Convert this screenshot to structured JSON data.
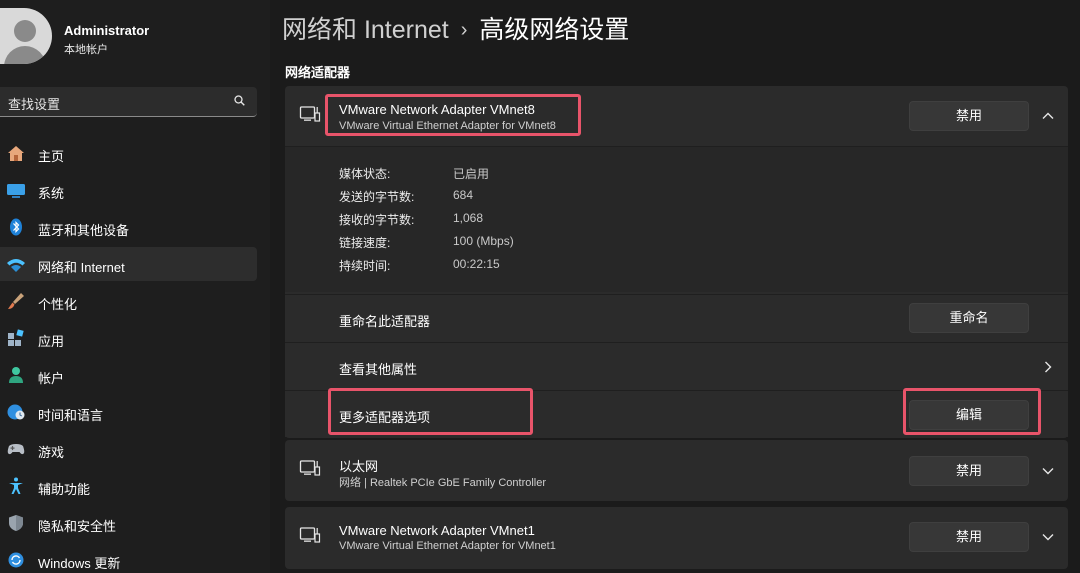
{
  "profile": {
    "name": "Administrator",
    "account_type": "本地帐户"
  },
  "search": {
    "text": "查找设置"
  },
  "sidebar": {
    "items": [
      {
        "label": "主页",
        "icon": "home-icon"
      },
      {
        "label": "系统",
        "icon": "system-icon"
      },
      {
        "label": "蓝牙和其他设备",
        "icon": "bluetooth-icon"
      },
      {
        "label": "网络和 Internet",
        "icon": "wifi-icon",
        "active": true
      },
      {
        "label": "个性化",
        "icon": "brush-icon"
      },
      {
        "label": "应用",
        "icon": "apps-icon"
      },
      {
        "label": "帐户",
        "icon": "account-icon"
      },
      {
        "label": "时间和语言",
        "icon": "globe-clock-icon"
      },
      {
        "label": "游戏",
        "icon": "gamepad-icon"
      },
      {
        "label": "辅助功能",
        "icon": "accessibility-icon"
      },
      {
        "label": "隐私和安全性",
        "icon": "shield-icon"
      },
      {
        "label": "Windows 更新",
        "icon": "update-icon"
      }
    ]
  },
  "breadcrumb": {
    "parent": "网络和 Internet",
    "separator": "›",
    "current": "高级网络设置"
  },
  "section_title": "网络适配器",
  "adapters": [
    {
      "title": "VMware Network Adapter VMnet8",
      "subtitle": "VMware Virtual Ethernet Adapter for VMnet8",
      "button": "禁用",
      "expanded": true,
      "details": [
        {
          "label": "媒体状态:",
          "value": "已启用"
        },
        {
          "label": "发送的字节数:",
          "value": "684"
        },
        {
          "label": "接收的字节数:",
          "value": "1,068"
        },
        {
          "label": "链接速度:",
          "value": "100 (Mbps)"
        },
        {
          "label": "持续时间:",
          "value": "00:22:15"
        }
      ],
      "rows": [
        {
          "label": "重命名此适配器",
          "button": "重命名"
        },
        {
          "label": "查看其他属性"
        },
        {
          "label": "更多适配器选项",
          "button": "编辑"
        }
      ]
    },
    {
      "title": "以太网",
      "subtitle": "网络 | Realtek PCIe GbE Family Controller",
      "button": "禁用",
      "expanded": false
    },
    {
      "title": "VMware Network Adapter VMnet1",
      "subtitle": "VMware Virtual Ethernet Adapter for VMnet1",
      "button": "禁用",
      "expanded": false
    }
  ],
  "colors": {
    "background": "#1b1b1b",
    "card": "#2b2b2b",
    "highlight": "#e8546a",
    "accent_blue": "#4cc2ff"
  }
}
